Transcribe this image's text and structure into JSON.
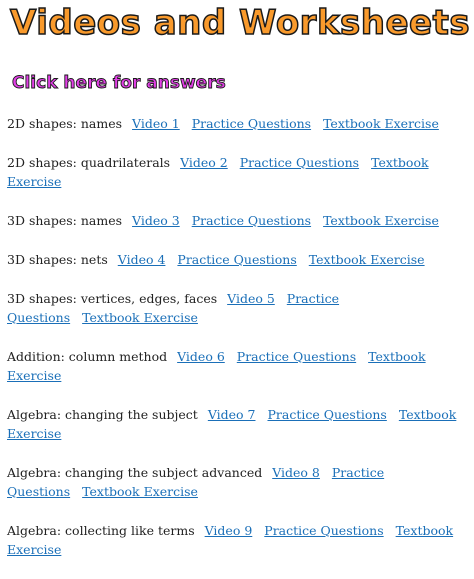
{
  "page": {
    "title": "Videos and Worksheets",
    "answers_link": "Click here for answers"
  },
  "topics": [
    {
      "label": "2D shapes: names",
      "video": "Video 1",
      "practice": "Practice Questions",
      "textbook": "Textbook Exercise"
    },
    {
      "label": "2D shapes: quadrilaterals",
      "video": "Video 2",
      "practice": "Practice Questions",
      "textbook": "Textbook Exercise"
    },
    {
      "label": "3D shapes: names",
      "video": "Video 3",
      "practice": "Practice Questions",
      "textbook": "Textbook Exercise"
    },
    {
      "label": "3D shapes: nets",
      "video": "Video 4",
      "practice": "Practice Questions",
      "textbook": "Textbook Exercise"
    },
    {
      "label": "3D shapes: vertices, edges, faces",
      "video": "Video 5",
      "practice": "Practice Questions",
      "textbook": "Textbook Exercise"
    },
    {
      "label": "Addition: column method",
      "video": "Video 6",
      "practice": "Practice Questions",
      "textbook": "Textbook Exercise"
    },
    {
      "label": "Algebra: changing the subject",
      "video": "Video 7",
      "practice": "Practice Questions",
      "textbook": "Textbook Exercise"
    },
    {
      "label": "Algebra: changing the subject advanced",
      "video": "Video 8",
      "practice": "Practice Questions",
      "textbook": "Textbook Exercise"
    },
    {
      "label": "Algebra: collecting like terms",
      "video": "Video 9",
      "practice": "Practice Questions",
      "textbook": "Textbook Exercise"
    }
  ],
  "colors": {
    "title_fill": "#f99a2c",
    "answers_fill": "#e23fe6",
    "link": "#1a6fb8"
  }
}
